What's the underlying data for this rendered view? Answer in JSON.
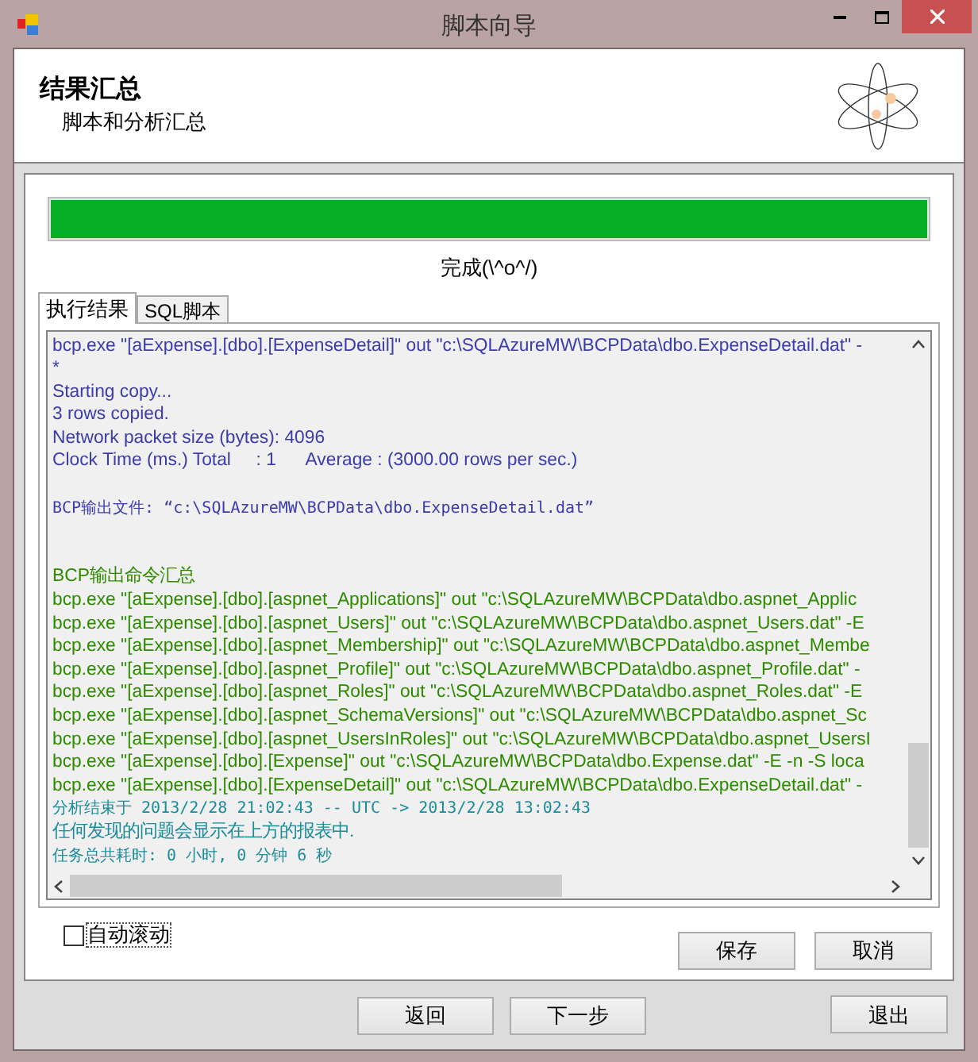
{
  "window": {
    "title": "脚本向导"
  },
  "header": {
    "title": "结果汇总",
    "subtitle": "脚本和分析汇总"
  },
  "progress": {
    "level": 1,
    "status": "完成(\\^o^/)"
  },
  "tabs": [
    {
      "label": "执行结果",
      "selected": true
    },
    {
      "label": "SQL脚本",
      "selected": false
    }
  ],
  "output": [
    {
      "kind": "text",
      "color": "#3c3caa",
      "text": "bcp.exe \"[aExpense].[dbo].[ExpenseDetail]\" out \"c:\\SQLAzureMW\\BCPData\\dbo.ExpenseDetail.dat\" -"
    },
    {
      "kind": "text",
      "color": "#3c3caa",
      "text": "*"
    },
    {
      "kind": "text",
      "color": "#3c3caa",
      "text": "Starting copy..."
    },
    {
      "kind": "text",
      "color": "#3c3caa",
      "text": "3 rows copied."
    },
    {
      "kind": "text",
      "color": "#3c3caa",
      "text": "Network packet size (bytes): 4096"
    },
    {
      "kind": "text",
      "color": "#3c3caa",
      "text": "Clock Time (ms.) Total     : 1      Average : (3000.00 rows per sec.)"
    },
    {
      "kind": "blank"
    },
    {
      "kind": "mono",
      "color": "#3c3caa",
      "text": "BCP输出文件: “c:\\SQLAzureMW\\BCPData\\dbo.ExpenseDetail.dat”"
    },
    {
      "kind": "blank"
    },
    {
      "kind": "blank"
    },
    {
      "kind": "text",
      "color": "#2e8b00",
      "text": "BCP输出命令汇总"
    },
    {
      "kind": "text",
      "color": "#2e8b00",
      "text": "bcp.exe \"[aExpense].[dbo].[aspnet_Applications]\" out \"c:\\SQLAzureMW\\BCPData\\dbo.aspnet_Applic"
    },
    {
      "kind": "text",
      "color": "#2e8b00",
      "text": "bcp.exe \"[aExpense].[dbo].[aspnet_Users]\" out \"c:\\SQLAzureMW\\BCPData\\dbo.aspnet_Users.dat\" -E"
    },
    {
      "kind": "text",
      "color": "#2e8b00",
      "text": "bcp.exe \"[aExpense].[dbo].[aspnet_Membership]\" out \"c:\\SQLAzureMW\\BCPData\\dbo.aspnet_Membe"
    },
    {
      "kind": "text",
      "color": "#2e8b00",
      "text": "bcp.exe \"[aExpense].[dbo].[aspnet_Profile]\" out \"c:\\SQLAzureMW\\BCPData\\dbo.aspnet_Profile.dat\" -"
    },
    {
      "kind": "text",
      "color": "#2e8b00",
      "text": "bcp.exe \"[aExpense].[dbo].[aspnet_Roles]\" out \"c:\\SQLAzureMW\\BCPData\\dbo.aspnet_Roles.dat\" -E"
    },
    {
      "kind": "text",
      "color": "#2e8b00",
      "text": "bcp.exe \"[aExpense].[dbo].[aspnet_SchemaVersions]\" out \"c:\\SQLAzureMW\\BCPData\\dbo.aspnet_Sc"
    },
    {
      "kind": "text",
      "color": "#2e8b00",
      "text": "bcp.exe \"[aExpense].[dbo].[aspnet_UsersInRoles]\" out \"c:\\SQLAzureMW\\BCPData\\dbo.aspnet_UsersI"
    },
    {
      "kind": "text",
      "color": "#2e8b00",
      "text": "bcp.exe \"[aExpense].[dbo].[Expense]\" out \"c:\\SQLAzureMW\\BCPData\\dbo.Expense.dat\" -E -n -S loca"
    },
    {
      "kind": "text",
      "color": "#2e8b00",
      "text": "bcp.exe \"[aExpense].[dbo].[ExpenseDetail]\" out \"c:\\SQLAzureMW\\BCPData\\dbo.ExpenseDetail.dat\" -"
    },
    {
      "kind": "mono",
      "color": "#1a8c9a",
      "text": "分析结束于 2013/2/28 21:02:43 -- UTC -> 2013/2/28 13:02:43"
    },
    {
      "kind": "text",
      "color": "#1a8c9a",
      "text": "任何发现的问题会显示在上方的报表中."
    },
    {
      "kind": "mono",
      "color": "#1a8c9a",
      "text": "任务总共耗时: 0 小时, 0 分钟 6 秒"
    }
  ],
  "auto_scroll": {
    "label": "自动滚动",
    "checked": false
  },
  "panel_buttons": [
    "保存",
    "取消"
  ],
  "footer_buttons": [
    "返回",
    "下一步",
    "退出"
  ]
}
